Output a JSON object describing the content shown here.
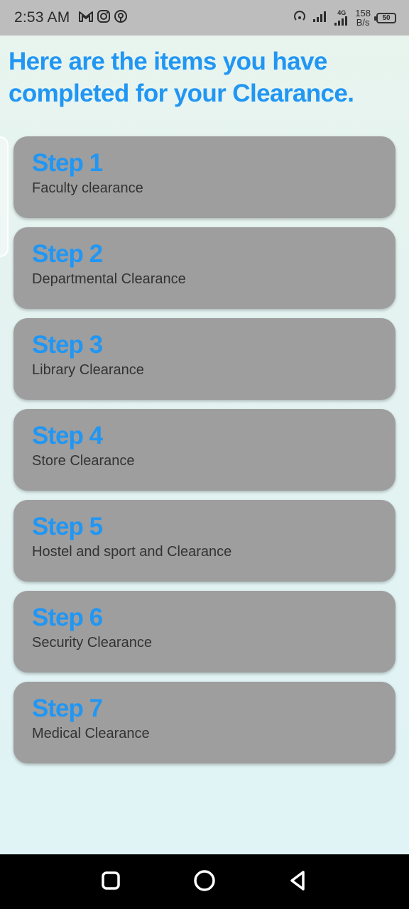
{
  "status_bar": {
    "time": "2:53 AM",
    "speed_value": "158",
    "speed_unit": "B/s",
    "battery": "50",
    "network_label": "4G"
  },
  "page": {
    "title": "Here are the items you have completed for your Clearance."
  },
  "steps": [
    {
      "title": "Step 1",
      "description": "Faculty clearance"
    },
    {
      "title": "Step 2",
      "description": "Departmental Clearance"
    },
    {
      "title": "Step 3",
      "description": "Library Clearance"
    },
    {
      "title": "Step 4",
      "description": "Store Clearance"
    },
    {
      "title": "Step 5",
      "description": "Hostel and sport and Clearance"
    },
    {
      "title": "Step 6",
      "description": "Security Clearance"
    },
    {
      "title": "Step 7",
      "description": "Medical Clearance"
    }
  ],
  "icons": {
    "notifications": [
      "gmail-icon",
      "instagram-icon",
      "hotspot-icon"
    ],
    "system": [
      "wifi-hotspot-icon",
      "signal-icon",
      "signal-4g-icon",
      "battery-icon"
    ],
    "nav": [
      "recents-icon",
      "home-icon",
      "back-icon"
    ]
  },
  "colors": {
    "accent": "#2196f3",
    "card": "#9e9e9e",
    "status_bar": "#bdbdbd",
    "nav_bar": "#000000"
  }
}
